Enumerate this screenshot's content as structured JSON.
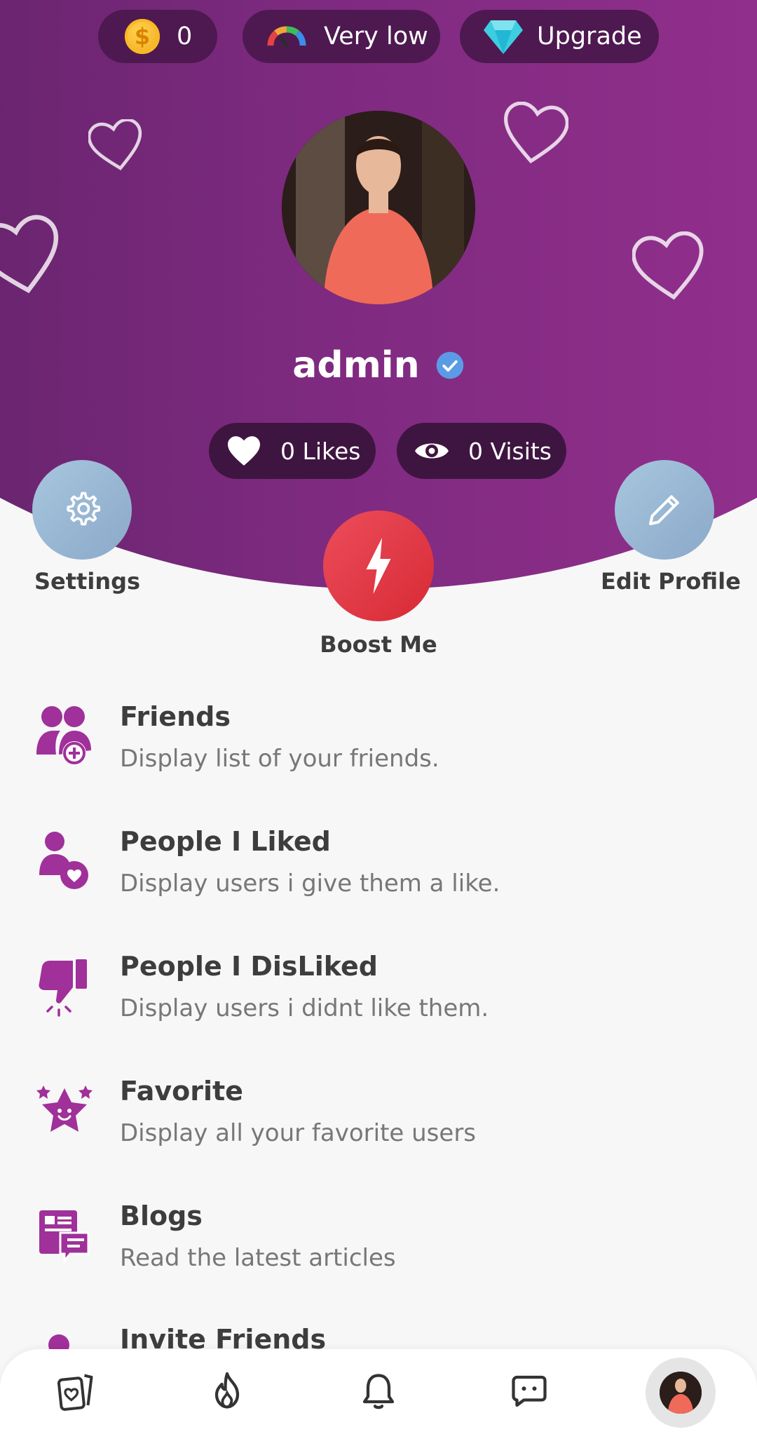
{
  "top_bar": {
    "coins": "0",
    "popularity": "Very low",
    "upgrade": "Upgrade"
  },
  "profile": {
    "username": "admin",
    "likes": "0 Likes",
    "visits": "0 Visits"
  },
  "actions": {
    "settings": "Settings",
    "boost": "Boost Me",
    "edit_profile": "Edit Profile"
  },
  "menu": [
    {
      "title": "Friends",
      "desc": "Display list of your friends.",
      "icon": "friends-add-icon"
    },
    {
      "title": "People I Liked",
      "desc": "Display users i give them a like.",
      "icon": "user-heart-icon"
    },
    {
      "title": "People I DisLiked",
      "desc": "Display users i didnt like them.",
      "icon": "thumbs-down-icon"
    },
    {
      "title": "Favorite",
      "desc": "Display all your favorite users",
      "icon": "star-face-icon"
    },
    {
      "title": "Blogs",
      "desc": "Read the latest articles",
      "icon": "blog-icon"
    },
    {
      "title": "Invite Friends",
      "desc": "",
      "icon": "invite-icon"
    }
  ],
  "bottom_nav": [
    "cards-icon",
    "fire-icon",
    "bell-icon",
    "chat-icon",
    "profile-avatar"
  ],
  "colors": {
    "brand_purple": "#8a2b87",
    "accent_red": "#e03a45",
    "icon_purple": "#a0309a",
    "pill_dark": "#4d1950"
  }
}
